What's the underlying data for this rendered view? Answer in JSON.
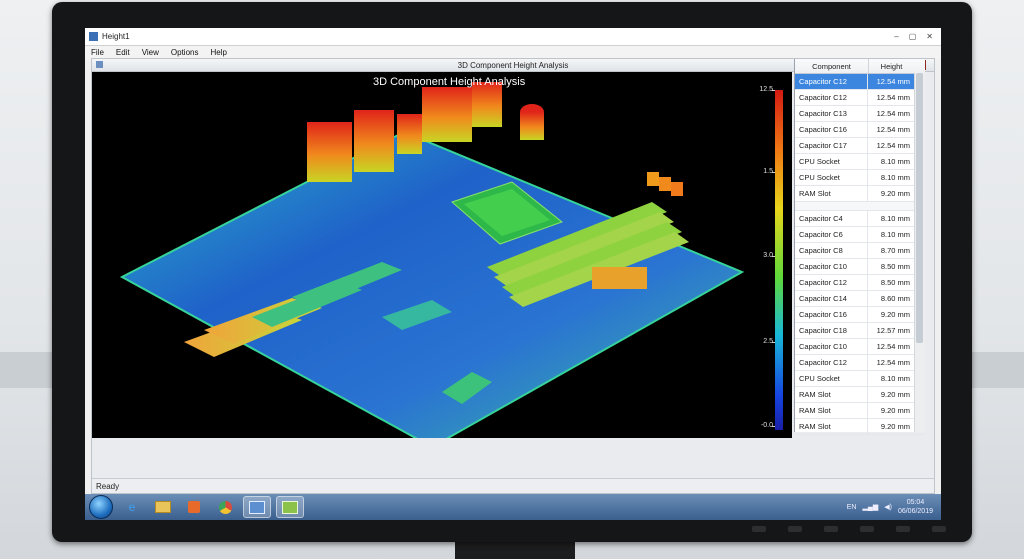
{
  "window": {
    "title": "Height1",
    "controls": [
      "–",
      "▢",
      "✕"
    ]
  },
  "menu": [
    "File",
    "Edit",
    "View",
    "Options",
    "Help"
  ],
  "child_window": {
    "title": "3D Component Height Analysis",
    "controls": [
      "–",
      "▢",
      "✕"
    ]
  },
  "viewport": {
    "title": "3D Component Height Analysis",
    "colorbar": {
      "colors": [
        "#d31a12",
        "#f07a14",
        "#e8d61a",
        "#5fd83a",
        "#18b8d8",
        "#1644e0",
        "#1a1fa8"
      ],
      "tick_labels": [
        "12.5",
        "1.5",
        "3.0",
        "2.5",
        "-0.0"
      ]
    }
  },
  "table": {
    "headers": [
      "Component",
      "Height"
    ],
    "group1": [
      {
        "component": "Capacitor C12",
        "height": "12.54 mm",
        "selected": true
      },
      {
        "component": "Capacitor C12",
        "height": "12.54 mm"
      },
      {
        "component": "Capacitor C13",
        "height": "12.54 mm"
      },
      {
        "component": "Capacitor C16",
        "height": "12.54 mm"
      },
      {
        "component": "Capacitor C17",
        "height": "12.54 mm"
      },
      {
        "component": "CPU Socket",
        "height": "8.10 mm"
      },
      {
        "component": "CPU Socket",
        "height": "8.10 mm"
      },
      {
        "component": "RAM Slot",
        "height": "9.20 mm"
      }
    ],
    "group2": [
      {
        "component": "Capacitor C4",
        "height": "8.10 mm"
      },
      {
        "component": "Capacitor C6",
        "height": "8.10 mm"
      },
      {
        "component": "Capacitor C8",
        "height": "8.70 mm"
      },
      {
        "component": "Capacitor C10",
        "height": "8.50 mm"
      },
      {
        "component": "Capacitor C12",
        "height": "8.50 mm"
      },
      {
        "component": "Capacitor C14",
        "height": "8.60 mm"
      },
      {
        "component": "Capacitor C16",
        "height": "9.20 mm"
      },
      {
        "component": "Capacitor C18",
        "height": "12.57 mm"
      },
      {
        "component": "Capacitor C10",
        "height": "12.54 mm"
      },
      {
        "component": "Capacitor C12",
        "height": "12.54 mm"
      },
      {
        "component": "CPU Socket",
        "height": "8.10 mm"
      },
      {
        "component": "RAM Slot",
        "height": "9.20 mm"
      },
      {
        "component": "RAM Slot",
        "height": "9.20 mm"
      },
      {
        "component": "RAM Slot",
        "height": "9.20 mm"
      }
    ]
  },
  "status": "Ready",
  "taskbar": {
    "apps": [
      "internet-explorer-icon",
      "file-explorer-icon",
      "media-player-icon",
      "chrome-icon",
      "analysis-app-icon",
      "height-app-icon"
    ],
    "tray_left": "EN",
    "clock_time": "05:04",
    "clock_date": "06/06/2019"
  }
}
